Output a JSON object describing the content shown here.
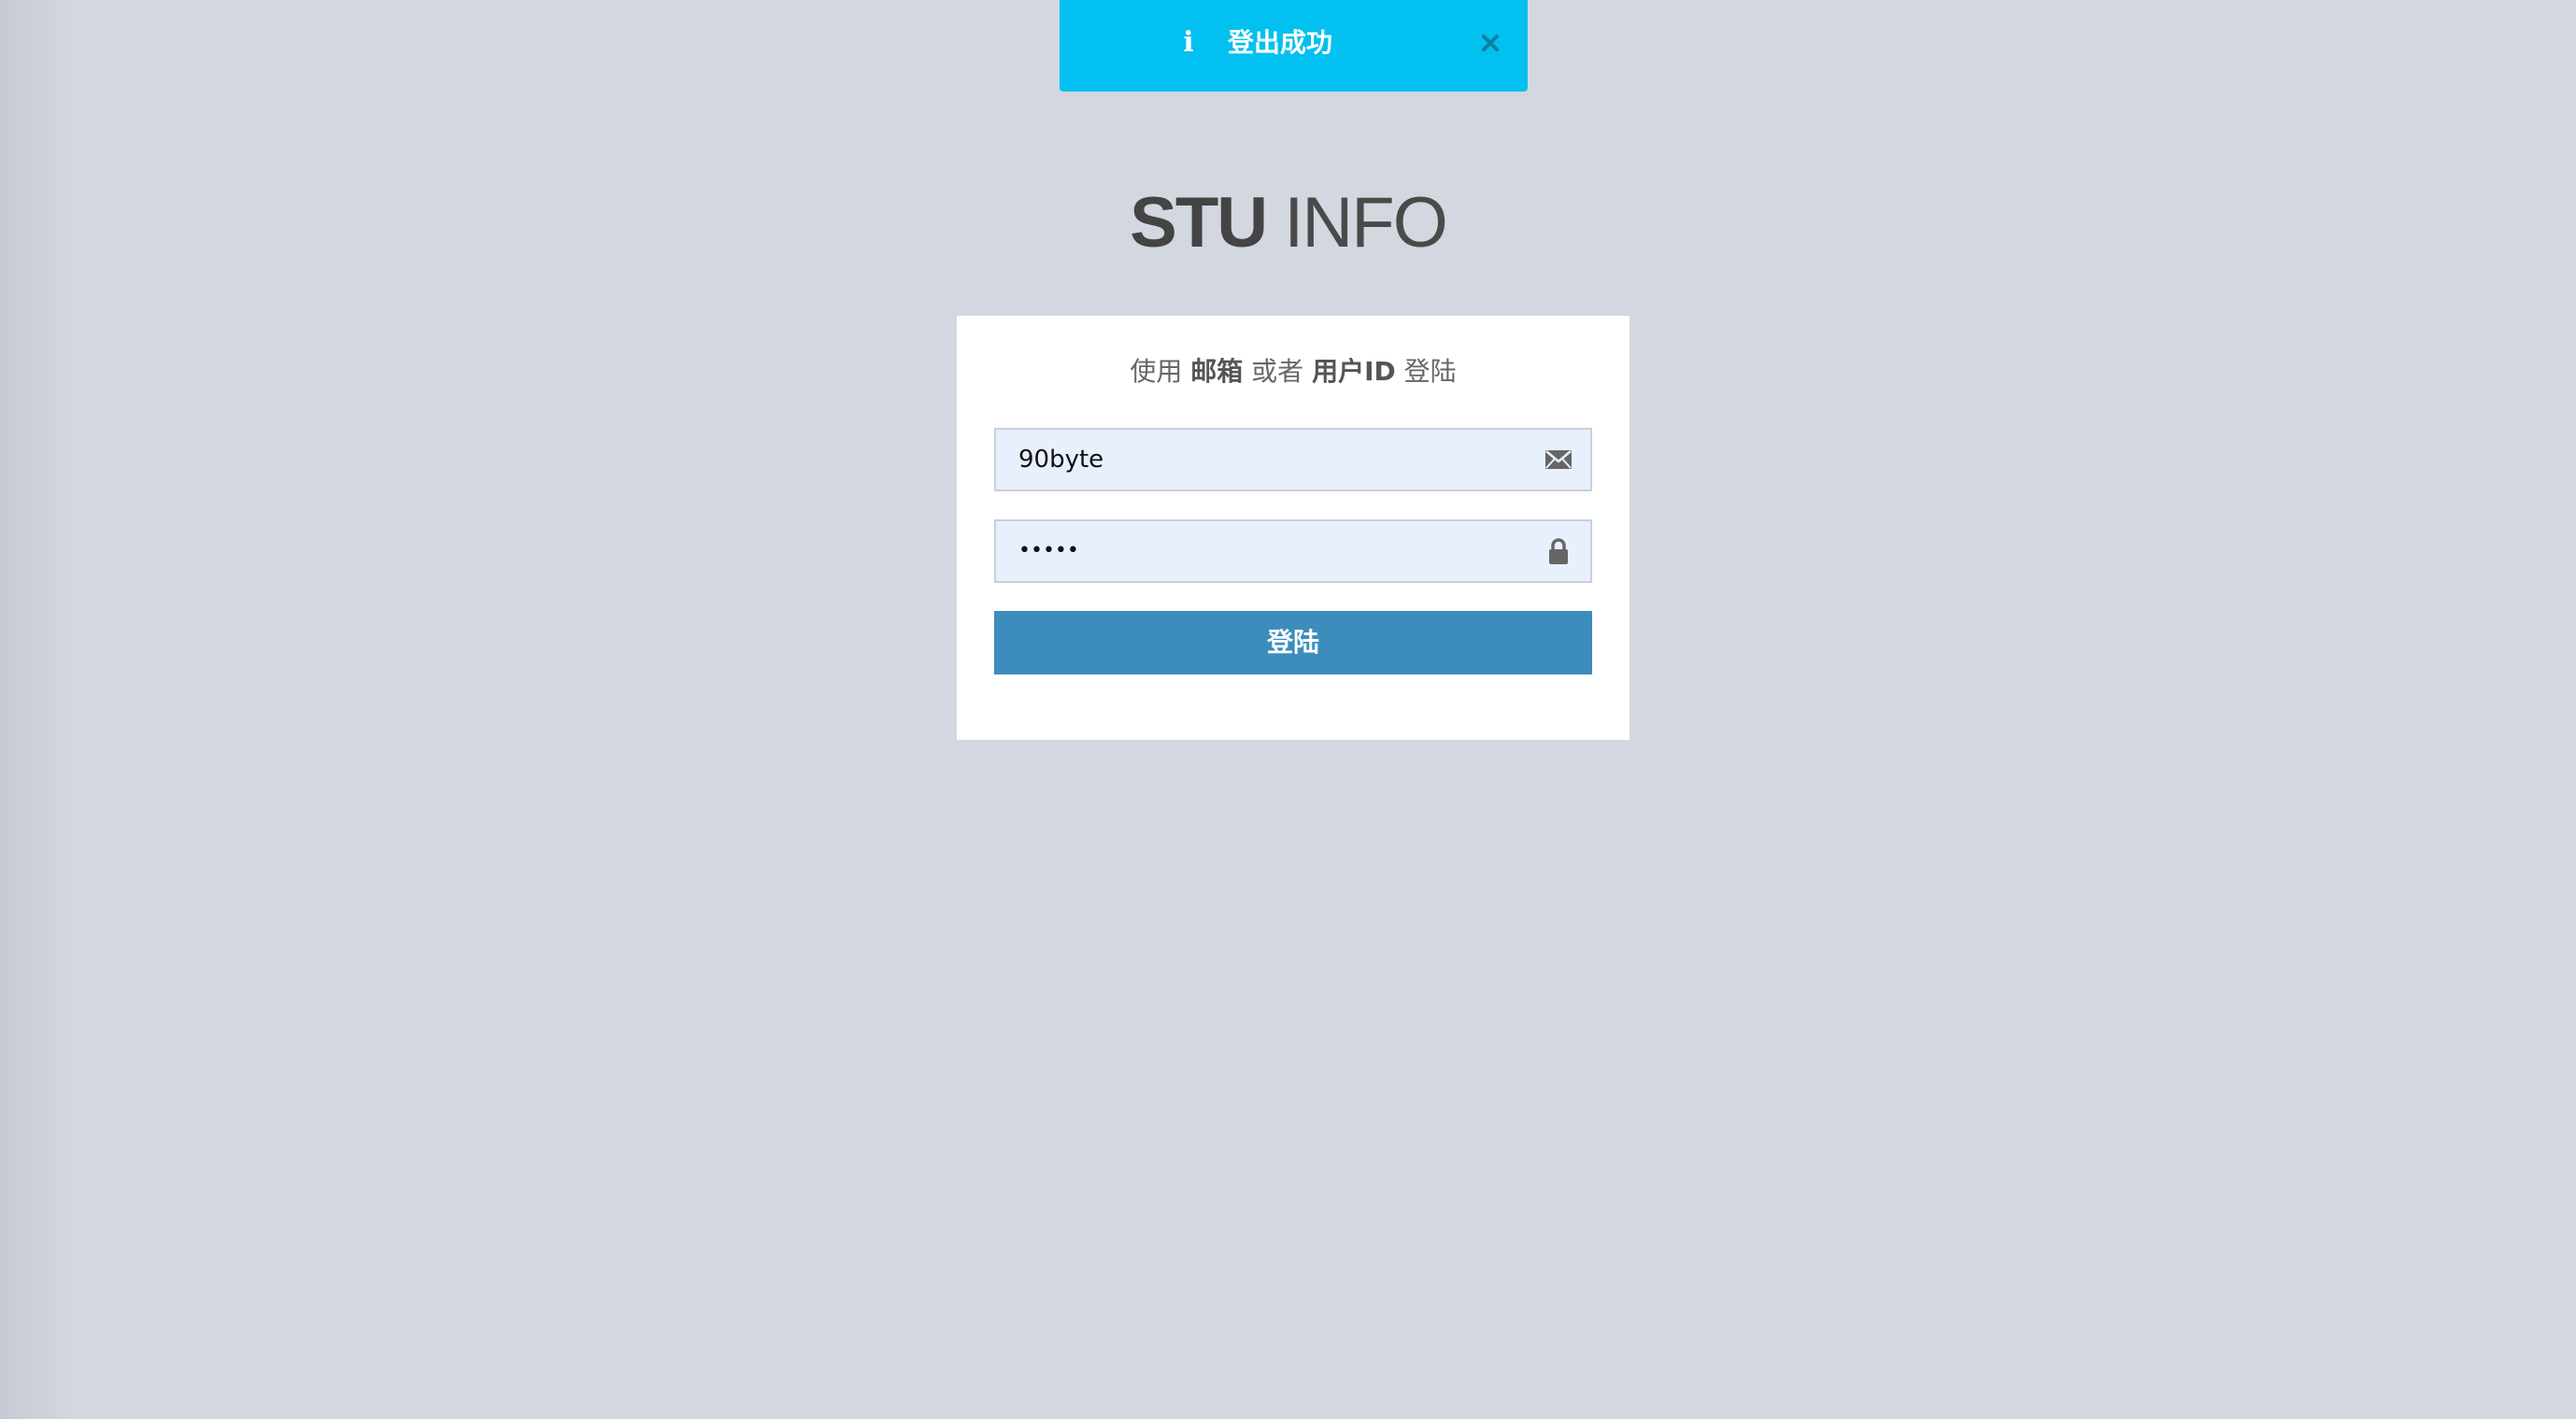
{
  "toast": {
    "message": "登出成功",
    "icon": "info-icon",
    "close_icon": "close-icon",
    "color": "#02c0ef"
  },
  "logo": {
    "bold": "STU",
    "light": "INFO"
  },
  "login": {
    "prompt": {
      "part1": "使用",
      "part2": "邮箱",
      "part3": "或者",
      "part4": "用户ID",
      "part5": "登陆"
    },
    "username_value": "90byte",
    "username_icon": "envelope-icon",
    "password_mask": "•••••",
    "password_icon": "lock-icon",
    "submit_label": "登陆",
    "submit_color": "#3c8dbc"
  }
}
